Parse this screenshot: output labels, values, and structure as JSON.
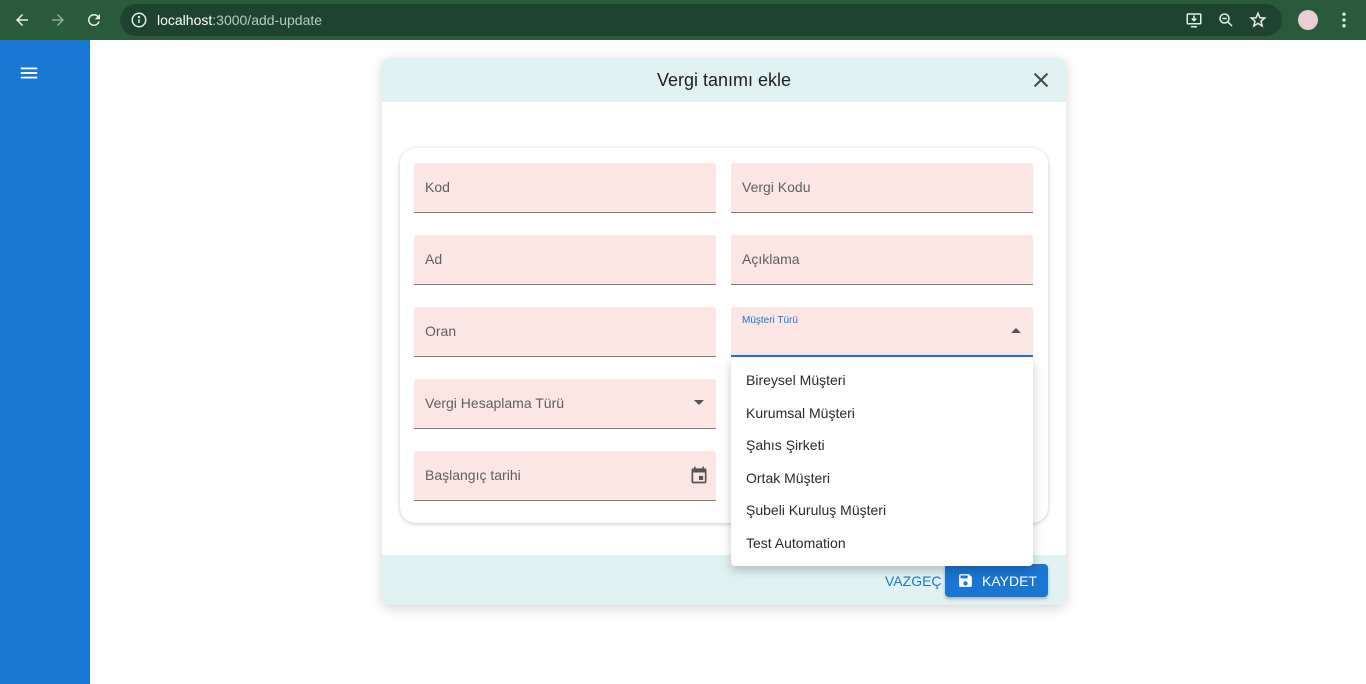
{
  "browser": {
    "url_host": "localhost",
    "url_path": ":3000/add-update"
  },
  "dialog": {
    "title": "Vergi tanımı ekle",
    "fields": {
      "kod": "Kod",
      "vergi_kodu": "Vergi Kodu",
      "ad": "Ad",
      "aciklama": "Açıklama",
      "oran": "Oran",
      "musteri_turu": "Müşteri Türü",
      "vergi_hesaplama_turu": "Vergi Hesaplama Türü",
      "baslangic_tarihi": "Başlangıç tarihi"
    },
    "cancel_label": "VAZGEÇ",
    "save_label": "KAYDET"
  },
  "dropdown": {
    "options": [
      "Bireysel Müşteri",
      "Kurumsal Müşteri",
      "Şahıs Şirketi",
      "Ortak Müşteri",
      "Şubeli Kuruluş Müşteri",
      "Test Automation"
    ]
  },
  "colors": {
    "primary": "#1976d2",
    "field_bg": "#fbe6e3",
    "header_bg": "#e0f1f1",
    "browser_bar": "#2b5a3b"
  }
}
